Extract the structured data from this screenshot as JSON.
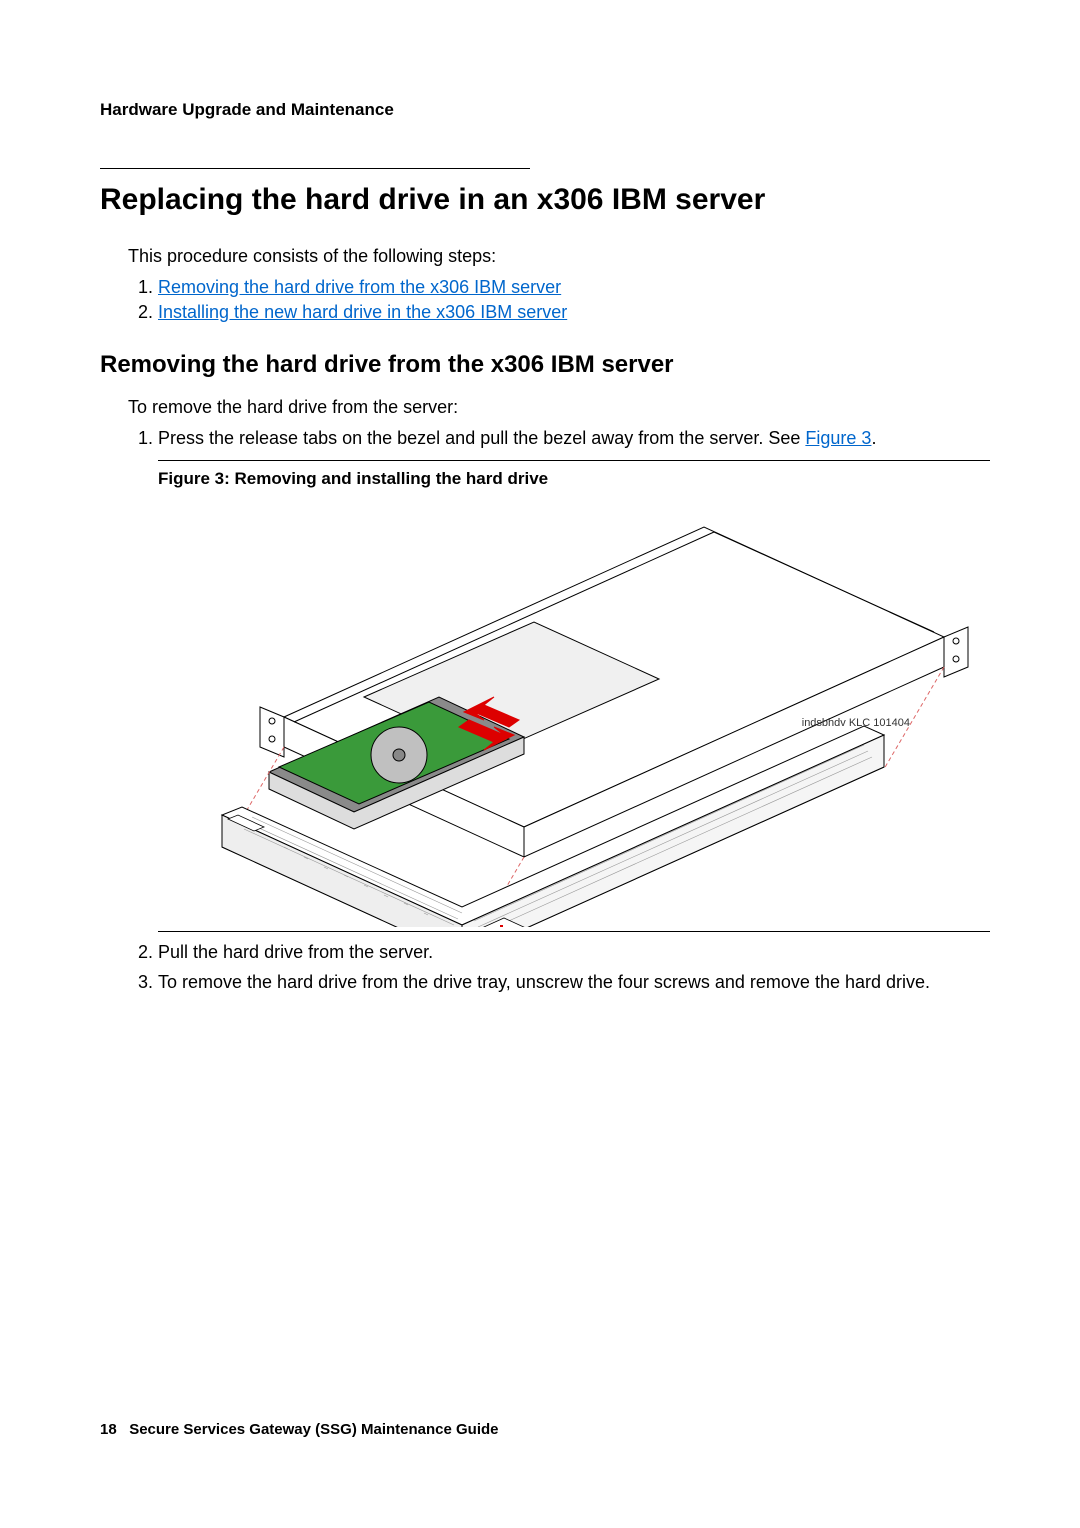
{
  "header": {
    "section_title": "Hardware Upgrade and Maintenance"
  },
  "title": "Replacing the hard drive in an x306 IBM server",
  "intro_text": "This procedure consists of the following steps:",
  "steps_links": [
    "Removing the hard drive from the x306 IBM server",
    "Installing the new hard drive in the x306 IBM server"
  ],
  "section": {
    "heading": "Removing the hard drive from the x306 IBM server",
    "lead": "To remove the hard drive from the server:",
    "step1_prefix": "Press the release tabs on the bezel and pull the bezel away from the server. See ",
    "step1_link": "Figure 3",
    "step1_suffix": ".",
    "step2": "Pull the hard drive from the server.",
    "step3": "To remove the hard drive from the drive tray, unscrew the four screws and remove the hard drive."
  },
  "figure": {
    "caption": "Figure 3: Removing and installing the hard drive",
    "credit": "indsbhdv KLC 101404"
  },
  "footer": {
    "page_number": "18",
    "doc_title": "Secure Services Gateway (SSG) Maintenance Guide"
  }
}
